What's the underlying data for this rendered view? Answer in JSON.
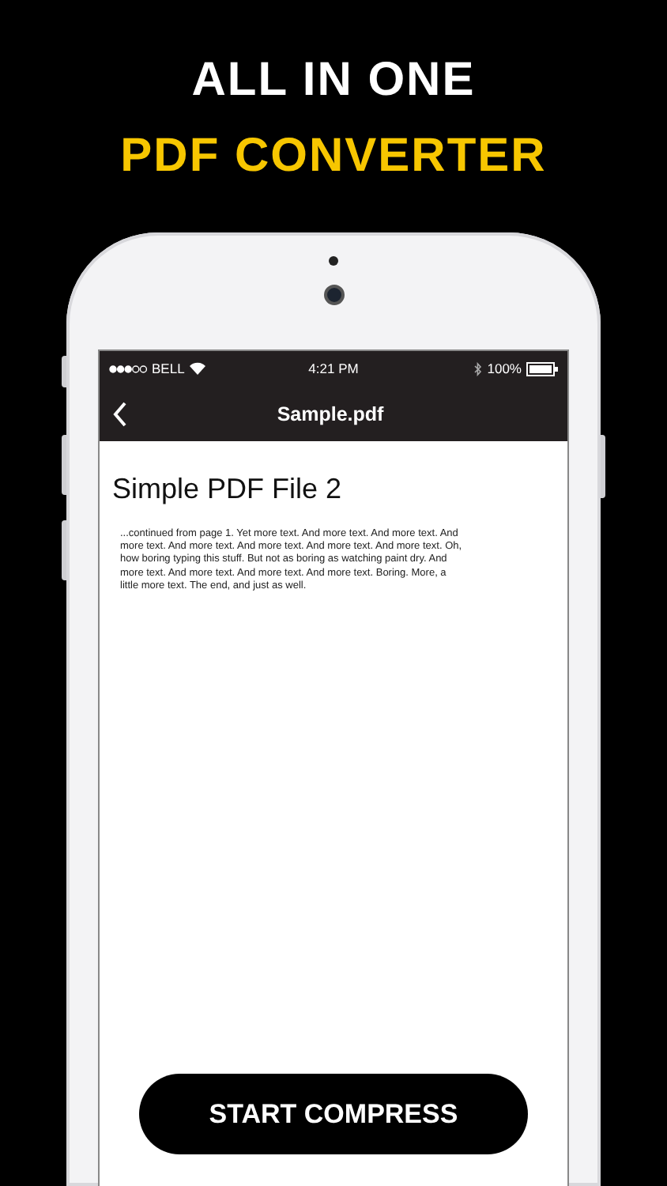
{
  "headline": {
    "line_1": "ALL IN ONE",
    "line_2": "PDF CONVERTER"
  },
  "status_bar": {
    "carrier": "BELL",
    "time": "4:21 PM",
    "battery": "100%"
  },
  "nav_bar": {
    "title": "Sample.pdf"
  },
  "document": {
    "title": "Simple PDF File 2",
    "body": "...continued from page 1. Yet more text. And more text. And more text. And more text. And more text. And more text. And more text. And more text. Oh, how boring typing this stuff. But not as boring as watching paint dry. And more text. And more text. And more text. And more text. Boring.  More, a little more text. The end, and just as well."
  },
  "action_button": {
    "label": "START COMPRESS"
  }
}
